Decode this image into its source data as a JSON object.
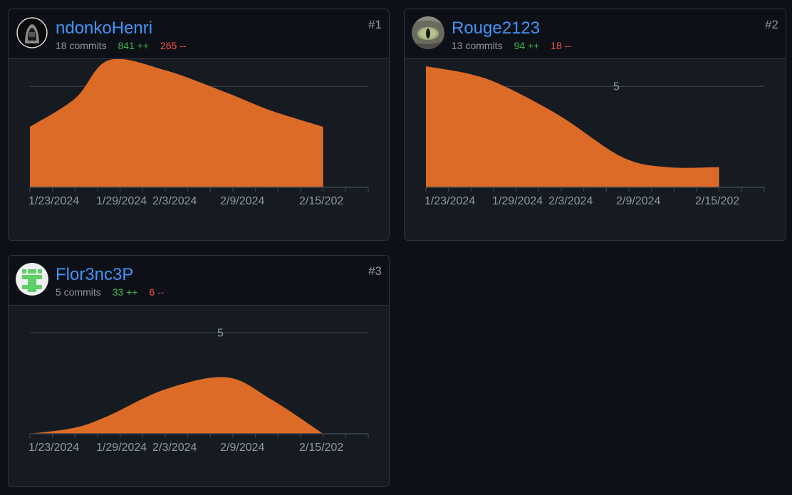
{
  "colors": {
    "area": "#dd6b28",
    "link": "#4493f8",
    "additions": "#3fb950",
    "deletions": "#f85149",
    "muted": "#9198a1"
  },
  "contributors": [
    {
      "username": "ndonkoHenri",
      "commits": "18 commits",
      "additions": "841 ++",
      "deletions": "265 --",
      "rank": "#1",
      "avatar_icon": "hooded-figure-avatar-icon",
      "chart_data": {
        "type": "area",
        "x_tick_labels": [
          "1/23/2024",
          "1/29/2024",
          "2/3/2024",
          "2/9/2024",
          "2/15/202"
        ],
        "y_tick_labels": [
          ""
        ],
        "y_grid_values": [
          5
        ],
        "ylim": [
          0,
          6
        ],
        "points": [
          [
            0,
            3
          ],
          [
            2,
            4.4
          ],
          [
            3.5,
            6.3
          ],
          [
            6,
            5.8
          ],
          [
            8.7,
            4.7
          ],
          [
            10.7,
            3.8
          ],
          [
            13,
            3.0
          ]
        ],
        "end_week": 13
      }
    },
    {
      "username": "Rouge2123",
      "commits": "13 commits",
      "additions": "94 ++",
      "deletions": "18 --",
      "rank": "#2",
      "avatar_icon": "cat-eye-avatar-icon",
      "chart_data": {
        "type": "area",
        "x_tick_labels": [
          "1/23/2024",
          "1/29/2024",
          "2/3/2024",
          "2/9/2024",
          "2/15/202"
        ],
        "y_tick_labels": [
          "5"
        ],
        "y_grid_values": [
          5
        ],
        "ylim": [
          0,
          6
        ],
        "points": [
          [
            0,
            6.0
          ],
          [
            2,
            5.6
          ],
          [
            3.5,
            5.0
          ],
          [
            6,
            3.5
          ],
          [
            8.7,
            1.5
          ],
          [
            10.7,
            1.0
          ],
          [
            13,
            1.0
          ]
        ],
        "end_week": 13
      }
    },
    {
      "username": "Flor3nc3P",
      "commits": "5 commits",
      "additions": "33 ++",
      "deletions": "6 --",
      "rank": "#3",
      "avatar_icon": "green-identicon-avatar-icon",
      "chart_data": {
        "type": "area",
        "x_tick_labels": [
          "1/23/2024",
          "1/29/2024",
          "2/3/2024",
          "2/9/2024",
          "2/15/202"
        ],
        "y_tick_labels": [
          "5"
        ],
        "y_grid_values": [
          5
        ],
        "ylim": [
          0,
          6
        ],
        "points": [
          [
            0,
            0
          ],
          [
            2,
            0.3
          ],
          [
            3.5,
            0.9
          ],
          [
            6,
            2.2
          ],
          [
            8.7,
            2.8
          ],
          [
            10.7,
            1.7
          ],
          [
            13,
            0
          ]
        ],
        "end_week": 13
      }
    }
  ]
}
